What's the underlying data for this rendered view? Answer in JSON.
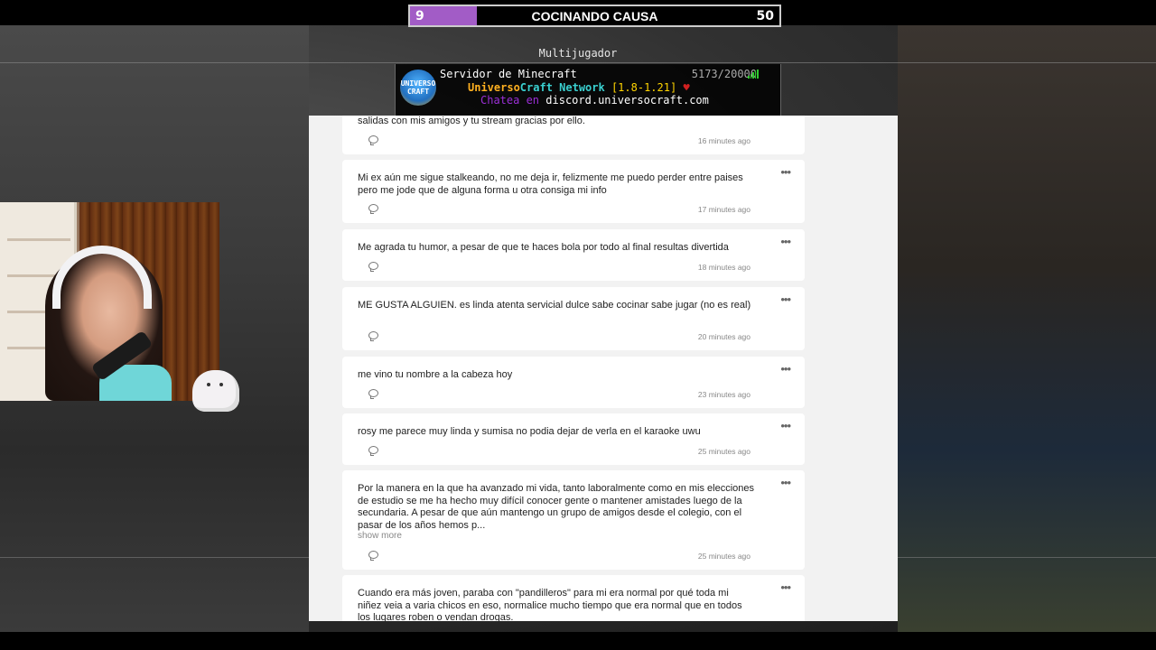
{
  "overlay": {
    "progress_current": "9",
    "progress_title": "COCINANDO CAUSA",
    "progress_goal": "50",
    "progress_fraction": 0.18,
    "progress_fill_color": "#a25cc6"
  },
  "minecraft": {
    "screen_title": "Multijugador",
    "server_name": "Servidor de Minecraft",
    "players": "5173/20000",
    "logo_text": "UNIVERSO CRAFT",
    "motd_brand_a": "Universo",
    "motd_brand_b": "Craft Network",
    "motd_version": "[1.8-1.21]",
    "motd_heart": "♥",
    "motd_chat_label": "Chatea en",
    "motd_chat_url": "discord.universocraft.com"
  },
  "comments": [
    {
      "text": "salidas con mis amigos y tu stream gracias por ello.",
      "time": "16 minutes ago"
    },
    {
      "text": "Mi ex aún me sigue stalkeando, no me deja ir, felizmente me puedo perder entre paises pero me jode que de alguna forma u otra consiga mi info",
      "time": "17 minutes ago"
    },
    {
      "text": "Me agrada tu humor, a pesar de que te haces bola por todo  al final resultas divertida",
      "time": "18 minutes ago"
    },
    {
      "text": "ME GUSTA ALGUIEN. es linda atenta servicial dulce sabe cocinar sabe jugar (no es real)",
      "time": "20 minutes ago"
    },
    {
      "text": "me vino tu nombre a la cabeza hoy",
      "time": "23 minutes ago"
    },
    {
      "text": "rosy me parece muy linda y sumisa no podia dejar de verla en el karaoke uwu",
      "time": "25 minutes ago"
    },
    {
      "text": "Por la manera en la que ha avanzado mi vida, tanto laboralmente como en mis elecciones de estudio se me ha hecho muy difícil conocer gente o mantener amistades luego de la secundaria. A pesar de que aún mantengo un grupo de amigos desde el colegio, con el pasar de los años hemos p...",
      "show_more": "show more",
      "time": "25 minutes ago"
    },
    {
      "text": "Cuando era más joven, paraba con \"pandilleros\" para mi era normal por qué toda mi niñez veia a varia chicos en eso, normalice mucho tiempo que era normal que en todos los lugares roben o vendan drogas.",
      "time": ""
    }
  ],
  "more_glyph": "•••"
}
